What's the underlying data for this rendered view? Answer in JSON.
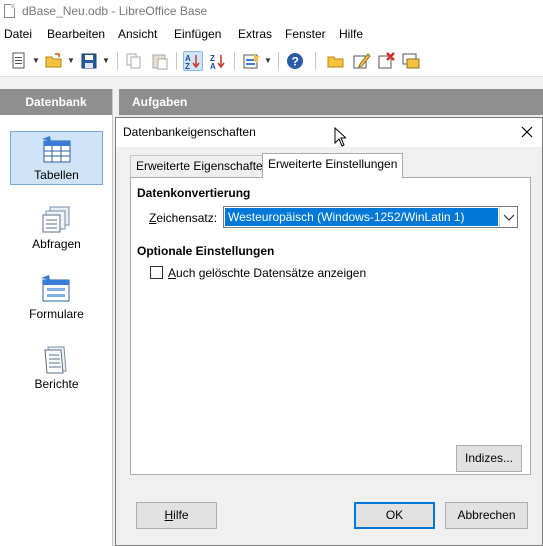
{
  "window": {
    "title": "dBase_Neu.odb - LibreOffice Base"
  },
  "menubar": {
    "items": [
      {
        "label": "Datei"
      },
      {
        "label": "Bearbeiten"
      },
      {
        "label": "Ansicht"
      },
      {
        "label": "Einfügen"
      },
      {
        "label": "Extras"
      },
      {
        "label": "Fenster"
      },
      {
        "label": "Hilfe"
      }
    ]
  },
  "toolbar": {
    "icons": [
      "new-document-icon",
      "open-folder-icon",
      "save-icon",
      "copy-icon",
      "paste-icon",
      "sort-ascending-icon",
      "sort-descending-icon",
      "new-form-icon",
      "help-icon",
      "open-database-object-icon",
      "edit-icon",
      "delete-icon",
      "rename-icon"
    ]
  },
  "database_panel": {
    "header": "Datenbank",
    "items": [
      {
        "label": "Tabellen",
        "icon": "table-icon",
        "selected": true
      },
      {
        "label": "Abfragen",
        "icon": "query-icon",
        "selected": false
      },
      {
        "label": "Formulare",
        "icon": "form-icon",
        "selected": false
      },
      {
        "label": "Berichte",
        "icon": "report-icon",
        "selected": false
      }
    ]
  },
  "tasks_panel": {
    "header": "Aufgaben"
  },
  "dialog": {
    "title": "Datenbankeigenschaften",
    "tabs": [
      {
        "label": "Erweiterte Eigenschaften",
        "active": false
      },
      {
        "label": "Erweiterte Einstellungen",
        "active": true
      }
    ],
    "conversion_section": "Datenkonvertierung",
    "charset_label": "Zeichensatz:",
    "charset_value": "Westeuropäisch (Windows-1252/WinLatin 1)",
    "optional_section": "Optionale Einstellungen",
    "show_deleted_label": "Auch gelöschte Datensätze anzeigen",
    "show_deleted_checked": false,
    "indexes_button": "Indizes...",
    "help_button": "Hilfe",
    "ok_button": "OK",
    "cancel_button": "Abbrechen"
  }
}
